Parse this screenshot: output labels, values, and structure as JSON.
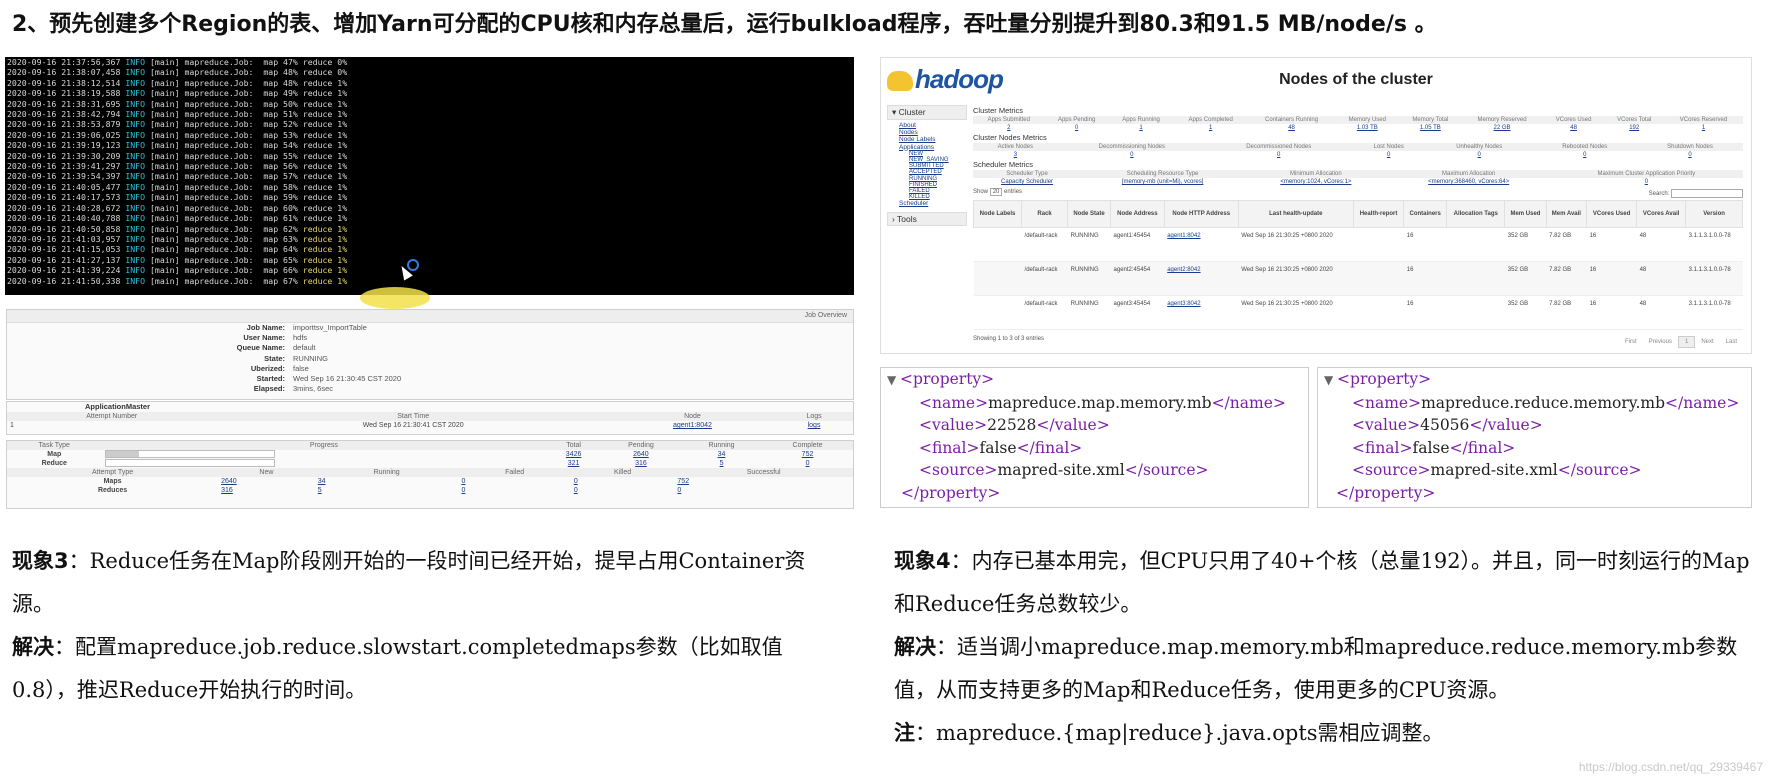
{
  "heading": "2、预先创建多个Region的表、增加Yarn可分配的CPU核和内存总量后，运行bulkload程序，吞吐量分别提升到80.3和91.5 MB/node/s 。",
  "terminal": {
    "lines": [
      {
        "ts": "2020-09-16 21:37:56,367",
        "level": "INFO",
        "rest": " [main] mapreduce.Job:  map 47% ",
        "reduce": "reduce 0%"
      },
      {
        "ts": "2020-09-16 21:38:07,458",
        "level": "INFO",
        "rest": " [main] mapreduce.Job:  map 48% ",
        "reduce": "reduce 0%"
      },
      {
        "ts": "2020-09-16 21:38:12,514",
        "level": "INFO",
        "rest": " [main] mapreduce.Job:  map 48% ",
        "reduce": "reduce 1%"
      },
      {
        "ts": "2020-09-16 21:38:19,588",
        "level": "INFO",
        "rest": " [main] mapreduce.Job:  map 49% ",
        "reduce": "reduce 1%"
      },
      {
        "ts": "2020-09-16 21:38:31,695",
        "level": "INFO",
        "rest": " [main] mapreduce.Job:  map 50% ",
        "reduce": "reduce 1%"
      },
      {
        "ts": "2020-09-16 21:38:42,794",
        "level": "INFO",
        "rest": " [main] mapreduce.Job:  map 51% ",
        "reduce": "reduce 1%"
      },
      {
        "ts": "2020-09-16 21:38:53,879",
        "level": "INFO",
        "rest": " [main] mapreduce.Job:  map 52% ",
        "reduce": "reduce 1%"
      },
      {
        "ts": "2020-09-16 21:39:06,025",
        "level": "INFO",
        "rest": " [main] mapreduce.Job:  map 53% ",
        "reduce": "reduce 1%"
      },
      {
        "ts": "2020-09-16 21:39:19,123",
        "level": "INFO",
        "rest": " [main] mapreduce.Job:  map 54% ",
        "reduce": "reduce 1%"
      },
      {
        "ts": "2020-09-16 21:39:30,209",
        "level": "INFO",
        "rest": " [main] mapreduce.Job:  map 55% ",
        "reduce": "reduce 1%"
      },
      {
        "ts": "2020-09-16 21:39:41,297",
        "level": "INFO",
        "rest": " [main] mapreduce.Job:  map 56% ",
        "reduce": "reduce 1%"
      },
      {
        "ts": "2020-09-16 21:39:54,397",
        "level": "INFO",
        "rest": " [main] mapreduce.Job:  map 57% ",
        "reduce": "reduce 1%"
      },
      {
        "ts": "2020-09-16 21:40:05,477",
        "level": "INFO",
        "rest": " [main] mapreduce.Job:  map 58% ",
        "reduce": "reduce 1%"
      },
      {
        "ts": "2020-09-16 21:40:17,573",
        "level": "INFO",
        "rest": " [main] mapreduce.Job:  map 59% ",
        "reduce": "reduce 1%"
      },
      {
        "ts": "2020-09-16 21:40:28,672",
        "level": "INFO",
        "rest": " [main] mapreduce.Job:  map 60% ",
        "reduce": "reduce 1%"
      },
      {
        "ts": "2020-09-16 21:40:40,788",
        "level": "INFO",
        "rest": " [main] mapreduce.Job:  map 61% ",
        "reduce": "reduce 1%"
      },
      {
        "ts": "2020-09-16 21:40:50,858",
        "level": "INFO",
        "rest": " [main] mapreduce.Job:  map 62% ",
        "reduce": "reduce 1%",
        "hl": true
      },
      {
        "ts": "2020-09-16 21:41:03,957",
        "level": "INFO",
        "rest": " [main] mapreduce.Job:  map 63% ",
        "reduce": "reduce 1%",
        "hl": true
      },
      {
        "ts": "2020-09-16 21:41:15,053",
        "level": "INFO",
        "rest": " [main] mapreduce.Job:  map 64% ",
        "reduce": "reduce 1%",
        "hl": true
      },
      {
        "ts": "2020-09-16 21:41:27,137",
        "level": "INFO",
        "rest": " [main] mapreduce.Job:  map 65% ",
        "reduce": "reduce 1%",
        "hl": true
      },
      {
        "ts": "2020-09-16 21:41:39,224",
        "level": "INFO",
        "rest": " [main] mapreduce.Job:  map 66% ",
        "reduce": "reduce 1%",
        "hl": true
      },
      {
        "ts": "2020-09-16 21:41:50,338",
        "level": "INFO",
        "rest": " [main] mapreduce.Job:  map 67% ",
        "reduce": "reduce 1%",
        "hl": true
      }
    ]
  },
  "job_overview": {
    "header": "Job Overview",
    "fields": [
      {
        "k": "Job Name:",
        "v": "importtsv_ImportTable"
      },
      {
        "k": "User Name:",
        "v": "hdfs"
      },
      {
        "k": "Queue Name:",
        "v": "default"
      },
      {
        "k": "State:",
        "v": "RUNNING"
      },
      {
        "k": "Uberized:",
        "v": "false"
      },
      {
        "k": "Started:",
        "v": "Wed Sep 16 21:30:45 CST 2020"
      },
      {
        "k": "Elapsed:",
        "v": "3mins, 6sec"
      }
    ]
  },
  "app_master": {
    "title": "ApplicationMaster",
    "cols": [
      "Attempt Number",
      "Start Time",
      "Node",
      "Logs"
    ],
    "row": [
      "1",
      "Wed Sep 16 21:30:41 CST 2020",
      "agent1:8042",
      "logs"
    ]
  },
  "tasks": {
    "cols": [
      "Task Type",
      "Progress",
      "Total",
      "Pending",
      "Running",
      "Complete"
    ],
    "rows": [
      {
        "type": "Map",
        "progress": 0.2,
        "total": "3426",
        "pending": "2640",
        "running": "34",
        "complete": "752"
      },
      {
        "type": "Reduce",
        "progress": 0,
        "total": "321",
        "pending": "316",
        "running": "5",
        "complete": "0"
      }
    ],
    "attempt_cols": [
      "Attempt Type",
      "New",
      "Running",
      "Failed",
      "Killed",
      "Successful"
    ],
    "attempt_rows": [
      {
        "type": "Maps",
        "new": "2640",
        "running": "34",
        "failed": "0",
        "killed": "0",
        "successful": "752"
      },
      {
        "type": "Reduces",
        "new": "316",
        "running": "5",
        "failed": "0",
        "killed": "0",
        "successful": "0"
      }
    ]
  },
  "hadoop": {
    "logo": "hadoop",
    "title": "Nodes of the cluster",
    "side": {
      "cluster": "Cluster",
      "links": [
        "About",
        "Nodes",
        "Node Labels",
        "Applications"
      ],
      "sub": [
        "NEW",
        "NEW_SAVING",
        "SUBMITTED",
        "ACCEPTED",
        "RUNNING",
        "FINISHED",
        "FAILED",
        "KILLED"
      ],
      "scheduler": "Scheduler",
      "tools": "Tools"
    },
    "cluster_metrics": {
      "title": "Cluster Metrics",
      "cols": [
        "Apps Submitted",
        "Apps Pending",
        "Apps Running",
        "Apps Completed",
        "Containers Running",
        "Memory Used",
        "Memory Total",
        "Memory Reserved",
        "VCores Used",
        "VCores Total",
        "VCores Reserved"
      ],
      "vals": [
        "2",
        "0",
        "1",
        "1",
        "48",
        "1.03 TB",
        "1.05 TB",
        "22 GB",
        "48",
        "192",
        "1"
      ]
    },
    "node_metrics": {
      "title": "Cluster Nodes Metrics",
      "cols": [
        "Active Nodes",
        "Decommissioning Nodes",
        "Decommissioned Nodes",
        "Lost Nodes",
        "Unhealthy Nodes",
        "Rebooted Nodes",
        "Shutdown Nodes"
      ],
      "vals": [
        "3",
        "0",
        "0",
        "0",
        "0",
        "0",
        "0"
      ]
    },
    "sched_metrics": {
      "title": "Scheduler Metrics",
      "cols": [
        "Scheduler Type",
        "Scheduling Resource Type",
        "Minimum Allocation",
        "Maximum Allocation",
        "Maximum Cluster Application Priority"
      ],
      "vals": [
        "Capacity Scheduler",
        "[memory-mb (unit=Mi), vcores]",
        "<memory:1024, vCores:1>",
        "<memory:368460, vCores:64>",
        "0"
      ]
    },
    "show_label": "Show",
    "show_value": "20",
    "entries_label": "entries",
    "search_label": "Search:",
    "node_cols": [
      "Node Labels",
      "Rack",
      "Node State",
      "Node Address",
      "Node HTTP Address",
      "Last health-update",
      "Health-report",
      "Containers",
      "Allocation Tags",
      "Mem Used",
      "Mem Avail",
      "VCores Used",
      "VCores Avail",
      "Version"
    ],
    "nodes": [
      {
        "labels": "",
        "rack": "/default-rack",
        "state": "RUNNING",
        "addr": "agent1:45454",
        "http": "agent1:8042",
        "health": "Wed Sep 16 21:30:25 +0800 2020",
        "report": "",
        "containers": "16",
        "tags": "",
        "mused": "352 GB",
        "mavail": "7.82 GB",
        "vused": "16",
        "vavail": "48",
        "version": "3.1.1.3.1.0.0-78"
      },
      {
        "labels": "",
        "rack": "/default-rack",
        "state": "RUNNING",
        "addr": "agent2:45454",
        "http": "agent2:8042",
        "health": "Wed Sep 16 21:30:25 +0800 2020",
        "report": "",
        "containers": "16",
        "tags": "",
        "mused": "352 GB",
        "mavail": "7.82 GB",
        "vused": "16",
        "vavail": "48",
        "version": "3.1.1.3.1.0.0-78"
      },
      {
        "labels": "",
        "rack": "/default-rack",
        "state": "RUNNING",
        "addr": "agent3:45454",
        "http": "agent3:8042",
        "health": "Wed Sep 16 21:30:25 +0800 2020",
        "report": "",
        "containers": "16",
        "tags": "",
        "mused": "352 GB",
        "mavail": "7.82 GB",
        "vused": "16",
        "vavail": "48",
        "version": "3.1.1.3.1.0.0-78"
      }
    ],
    "showing": "Showing 1 to 3 of 3 entries",
    "pager": [
      "First",
      "Previous",
      "1",
      "Next",
      "Last"
    ]
  },
  "xml_left": {
    "open": "<property>",
    "name": "mapreduce.map.memory.mb",
    "value": "22528",
    "final": "false",
    "source": "mapred-site.xml",
    "close": "</property>"
  },
  "xml_right": {
    "open": "<property>",
    "name": "mapreduce.reduce.memory.mb",
    "value": "45056",
    "final": "false",
    "source": "mapred-site.xml",
    "close": "</property>"
  },
  "left_text": {
    "p1_label": "现象3",
    "p1_text": "：Reduce任务在Map阶段刚开始的一段时间已经开始，提早占用Container资源。",
    "p2_label": "解决",
    "p2_text": "：配置mapreduce.job.reduce.slowstart.completedmaps参数（比如取值0.8），推迟Reduce开始执行的时间。"
  },
  "right_text": {
    "p1_label": "现象4",
    "p1_text": "：内存已基本用完，但CPU只用了40+个核（总量192）。并且，同一时刻运行的Map和Reduce任务总数较少。",
    "p2_label": "解决",
    "p2_text": "：适当调小mapreduce.map.memory.mb和mapreduce.reduce.memory.mb参数值，从而支持更多的Map和Reduce任务，使用更多的CPU资源。",
    "p3_label": "注",
    "p3_text": "：mapreduce.{map|reduce}.java.opts需相应调整。"
  },
  "watermark": "https://blog.csdn.net/qq_29339467"
}
